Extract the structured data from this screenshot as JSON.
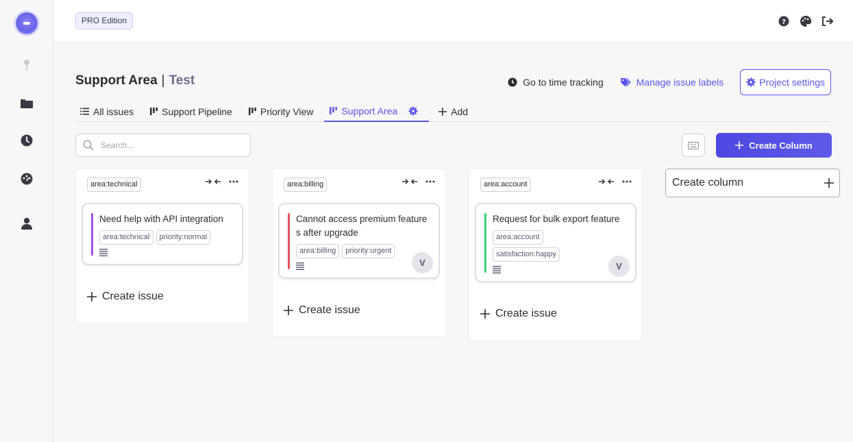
{
  "topbar": {
    "edition": "PRO Edition"
  },
  "header": {
    "project": "Support Area",
    "separator": "|",
    "subtitle": "Test",
    "time_tracking": "Go to time tracking",
    "manage_labels": "Manage issue labels",
    "project_settings": "Project settings"
  },
  "tabs": {
    "all_issues": "All issues",
    "support_pipeline": "Support Pipeline",
    "priority_view": "Priority View",
    "support_area": "Support Area",
    "add": "Add"
  },
  "search": {
    "placeholder": "Search..."
  },
  "toolbar": {
    "create_column": "Create Column"
  },
  "columns": [
    {
      "tag": "area:technical",
      "card": {
        "title": "Need help with API integration",
        "labels": [
          "area:technical",
          "priority:normal"
        ],
        "accent": "#a34de8",
        "avatar": ""
      },
      "create_issue": "Create issue"
    },
    {
      "tag": "area:billing",
      "card": {
        "title": "Cannot access premium features after upgrade",
        "labels": [
          "area:billing",
          "priority:urgent"
        ],
        "accent": "#e8505b",
        "avatar": "V"
      },
      "create_issue": "Create issue"
    },
    {
      "tag": "area:account",
      "card": {
        "title": "Request for bulk export feature",
        "labels": [
          "area:account",
          "satisfaction:happy"
        ],
        "accent": "#3fd07a",
        "avatar": "V"
      },
      "create_issue": "Create issue"
    }
  ],
  "new_column": {
    "label": "Create column"
  },
  "colors": {
    "accent": "#5b55e6"
  }
}
